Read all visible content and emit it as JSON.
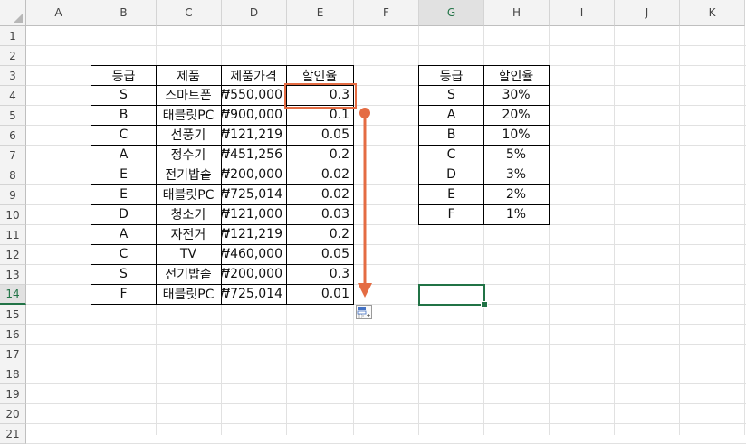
{
  "columns": [
    "A",
    "B",
    "C",
    "D",
    "E",
    "F",
    "G",
    "H",
    "I",
    "J",
    "K"
  ],
  "rows": [
    "1",
    "2",
    "3",
    "4",
    "5",
    "6",
    "7",
    "8",
    "9",
    "10",
    "11",
    "12",
    "13",
    "14",
    "15",
    "16",
    "17",
    "18",
    "19",
    "20",
    "21"
  ],
  "table1": {
    "headers": [
      "등급",
      "제품",
      "제품가격",
      "할인율"
    ],
    "rows": [
      [
        "S",
        "스마트폰",
        "₩550,000",
        "0.3"
      ],
      [
        "B",
        "태블릿PC",
        "₩900,000",
        "0.1"
      ],
      [
        "C",
        "선풍기",
        "₩121,219",
        "0.05"
      ],
      [
        "A",
        "정수기",
        "₩451,256",
        "0.2"
      ],
      [
        "E",
        "전기밥솥",
        "₩200,000",
        "0.02"
      ],
      [
        "E",
        "태블릿PC",
        "₩725,014",
        "0.02"
      ],
      [
        "D",
        "청소기",
        "₩121,000",
        "0.03"
      ],
      [
        "A",
        "자전거",
        "₩121,219",
        "0.2"
      ],
      [
        "C",
        "TV",
        "₩460,000",
        "0.05"
      ],
      [
        "S",
        "전기밥솥",
        "₩200,000",
        "0.3"
      ],
      [
        "F",
        "태블릿PC",
        "₩725,014",
        "0.01"
      ]
    ]
  },
  "table2": {
    "headers": [
      "등급",
      "할인율"
    ],
    "rows": [
      [
        "S",
        "30%"
      ],
      [
        "A",
        "20%"
      ],
      [
        "B",
        "10%"
      ],
      [
        "C",
        "5%"
      ],
      [
        "D",
        "3%"
      ],
      [
        "E",
        "2%"
      ],
      [
        "F",
        "1%"
      ]
    ]
  },
  "selection": {
    "cell": "G14",
    "active_row": "14"
  },
  "highlight": {
    "cell": "E4",
    "color": "#e46c43"
  },
  "colors": {
    "selection": "#217346",
    "annotation": "#e46c43",
    "grid": "#e1e1e1"
  },
  "icons": {
    "autofill": "auto-fill-options-icon"
  }
}
